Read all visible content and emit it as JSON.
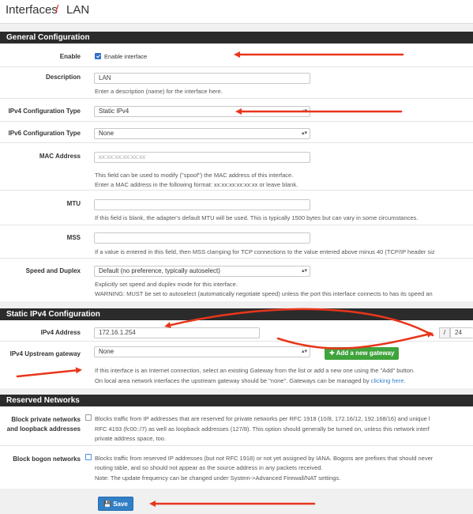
{
  "breadcrumb": {
    "part1": "Interfaces",
    "separator": "/",
    "part2": "LAN"
  },
  "sections": {
    "general": "General Configuration",
    "static_ipv4": "Static IPv4 Configuration",
    "reserved": "Reserved Networks"
  },
  "general": {
    "enable": {
      "label": "Enable",
      "checkbox_label": "Enable interface",
      "checked": true
    },
    "description": {
      "label": "Description",
      "value": "LAN",
      "help": "Enter a description (name) for the interface here."
    },
    "ipv4_type": {
      "label": "IPv4 Configuration Type",
      "value": "Static IPv4"
    },
    "ipv6_type": {
      "label": "IPv6 Configuration Type",
      "value": "None"
    },
    "mac": {
      "label": "MAC Address",
      "placeholder": "xx:xx:xx:xx:xx:xx",
      "help1": "This field can be used to modify (\"spoof\") the MAC address of this interface.",
      "help2": "Enter a MAC address in the following format: xx:xx:xx:xx:xx:xx or leave blank."
    },
    "mtu": {
      "label": "MTU",
      "help": "If this field is blank, the adapter's default MTU will be used. This is typically 1500 bytes but can vary in some circumstances."
    },
    "mss": {
      "label": "MSS",
      "help": "If a value is entered in this field, then MSS clamping for TCP connections to the value entered above minus 40 (TCP/IP header siz"
    },
    "speed": {
      "label": "Speed and Duplex",
      "value": "Default (no preference, typically autoselect)",
      "help1": "Explicitly set speed and duplex mode for this interface.",
      "help2": "WARNING: MUST be set to autoselect (automatically negotiate speed) unless the port this interface connects to has its speed an"
    }
  },
  "static_ipv4": {
    "address": {
      "label": "IPv4 Address",
      "value": "172.16.1.254",
      "slash": "/",
      "mask": "24"
    },
    "gateway": {
      "label": "IPv4 Upstream gateway",
      "value": "None",
      "button": "Add a new gateway",
      "help1": "If this interface is an Internet connection, select an existing Gateway from the list or add a new one using the \"Add\" button.",
      "help2_pre": "On local area network interfaces the upstream gateway should be \"none\". Gateways can be managed by ",
      "help2_link": "clicking here",
      "help2_post": "."
    }
  },
  "reserved": {
    "private": {
      "label1": "Block private networks",
      "label2": "and loopback addresses",
      "checked": false,
      "help1": "Blocks traffic from IP addresses that are reserved for private networks per RFC 1918 (10/8, 172.16/12, 192.168/16) and unique l",
      "help2": "RFC 4193 (fc00::/7) as well as loopback addresses (127/8). This option should generally be turned on, unless this network interf",
      "help3": "private address space, too."
    },
    "bogon": {
      "label": "Block bogon networks",
      "checked": false,
      "help1": "Blocks traffic from reserved IP addresses (but not RFC 1918) or not yet assigned by IANA. Bogons are prefixes that should never",
      "help2": "routing table, and so should not appear as the source address in any packets received.",
      "help3": "Note: The update frequency can be changed under System->Advanced Firewall/NAT settings."
    }
  },
  "footer": {
    "save": "Save"
  },
  "colors": {
    "header_bg": "#2b2b2b",
    "arrow": "#e8361c",
    "save_blue": "#317fc6",
    "add_green": "#3fa33c",
    "title_sep": "#e02a2a"
  },
  "icons": {
    "save": "floppy-disk-icon",
    "add": "plus-icon",
    "select": "caret-icon"
  }
}
